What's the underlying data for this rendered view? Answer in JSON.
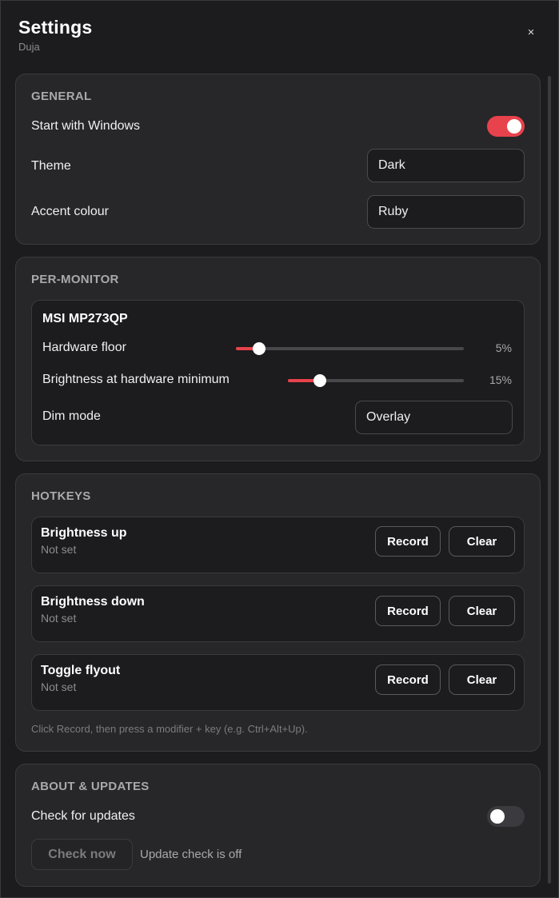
{
  "header": {
    "title": "Settings",
    "subtitle": "Duja",
    "close_label": "×"
  },
  "general": {
    "section_title": "GENERAL",
    "start_with_windows": {
      "label": "Start with Windows",
      "enabled": true
    },
    "theme": {
      "label": "Theme",
      "value": "Dark"
    },
    "accent": {
      "label": "Accent colour",
      "value": "Ruby"
    }
  },
  "per_monitor": {
    "section_title": "PER-MONITOR",
    "monitor_name": "MSI MP273QP",
    "hardware_floor": {
      "label": "Hardware floor",
      "value_text": "5%",
      "fraction": 0.1
    },
    "brightness_min": {
      "label": "Brightness at hardware minimum",
      "value_text": "15%",
      "fraction": 0.18
    },
    "dim_mode": {
      "label": "Dim mode",
      "value": "Overlay"
    }
  },
  "hotkeys": {
    "section_title": "HOTKEYS",
    "items": [
      {
        "name": "Brightness up",
        "status": "Not set",
        "record_label": "Record",
        "clear_label": "Clear"
      },
      {
        "name": "Brightness down",
        "status": "Not set",
        "record_label": "Record",
        "clear_label": "Clear"
      },
      {
        "name": "Toggle flyout",
        "status": "Not set",
        "record_label": "Record",
        "clear_label": "Clear"
      }
    ],
    "hint": "Click Record, then press a modifier + key (e.g. Ctrl+Alt+Up)."
  },
  "about": {
    "section_title": "ABOUT & UPDATES",
    "check_updates": {
      "label": "Check for updates",
      "enabled": false
    },
    "check_now_label": "Check now",
    "status": "Update check is off"
  },
  "colors": {
    "accent": "#e8424c",
    "background": "#1c1b1d",
    "card": "#272629"
  }
}
